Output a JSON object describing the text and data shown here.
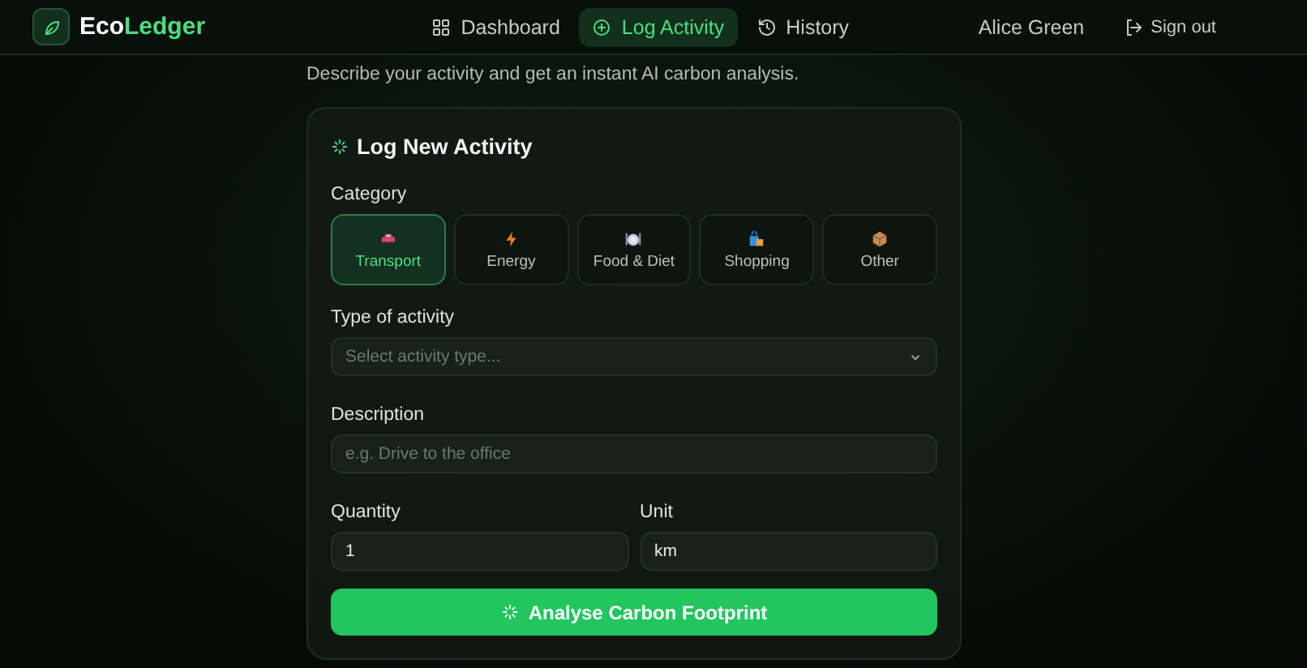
{
  "header": {
    "brand_first": "Eco",
    "brand_second": "Ledger",
    "nav": [
      {
        "label": "Dashboard",
        "kind": "grid",
        "selected": false
      },
      {
        "label": "Log Activity",
        "kind": "plus",
        "selected": true
      },
      {
        "label": "History",
        "kind": "history",
        "selected": false
      }
    ],
    "user": "Alice Green",
    "sign_out": "Sign out"
  },
  "subtitle": "Describe your activity and get an instant AI carbon analysis.",
  "form": {
    "title": "Log New Activity",
    "category_label": "Category",
    "categories": [
      {
        "label": "Transport",
        "kind": "car",
        "selected": true
      },
      {
        "label": "Energy",
        "kind": "bolt",
        "selected": false
      },
      {
        "label": "Food & Diet",
        "kind": "plate",
        "selected": false
      },
      {
        "label": "Shopping",
        "kind": "bag",
        "selected": false
      },
      {
        "label": "Other",
        "kind": "box",
        "selected": false
      }
    ],
    "type_label": "Type of activity",
    "type_placeholder": "Select activity type...",
    "description_label": "Description",
    "description_placeholder": "e.g. Drive to the office",
    "quantity_label": "Quantity",
    "quantity_value": "1",
    "unit_label": "Unit",
    "unit_value": "km",
    "submit": "Analyse Carbon Footprint"
  }
}
